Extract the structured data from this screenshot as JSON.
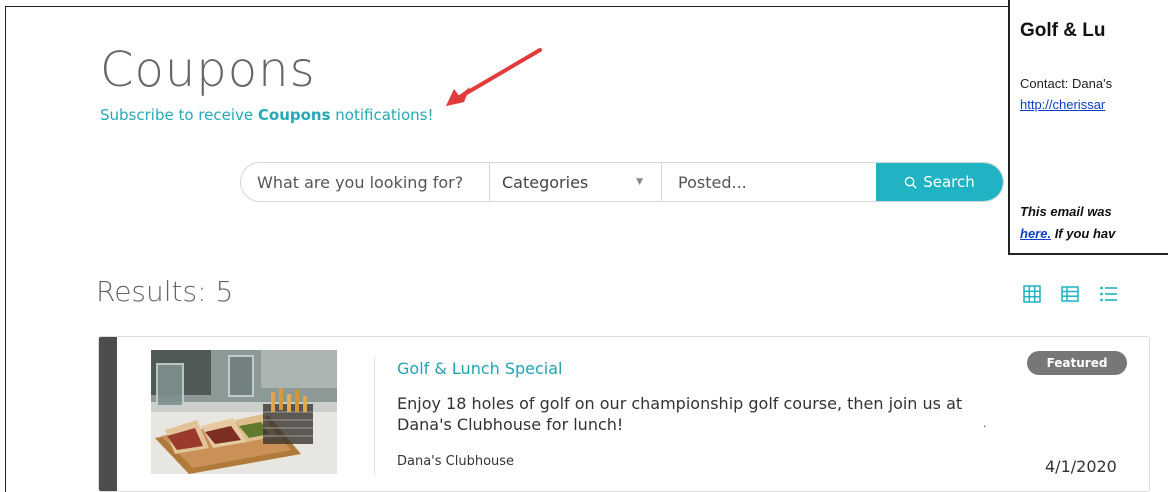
{
  "page": {
    "title": "Coupons",
    "subscribe": {
      "prefix": "Subscribe to receive ",
      "bold": "Coupons",
      "suffix": " notifications!"
    }
  },
  "search": {
    "keyword_placeholder": "What are you looking for?",
    "category_value": "Categories",
    "posted_placeholder": "Posted...",
    "button_label": "Search",
    "button_icon": "search-icon"
  },
  "results": {
    "label": "Results: 5",
    "view_icons": [
      "grid-view-icon",
      "table-view-icon",
      "list-view-icon"
    ]
  },
  "listing": {
    "title": "Golf & Lunch Special",
    "description": "Enjoy 18 holes of golf on our championship golf course, then join us at Dana's Clubhouse for lunch!",
    "business": "Dana's Clubhouse",
    "badge": "Featured",
    "date": "4/1/2020"
  },
  "email_preview": {
    "title": "Golf & Lu",
    "contact": "Contact: Dana's",
    "link": "http://cherissar",
    "note_line1": "This email was",
    "note_line2_link": "here.",
    "note_line2_rest": " If you hav"
  },
  "colors": {
    "accent": "#1fb3c3",
    "link_teal": "#1fa3b2",
    "badge_gray": "#777777",
    "card_bar": "#4d4d4d",
    "annotation_arrow": "#e23b3b"
  }
}
